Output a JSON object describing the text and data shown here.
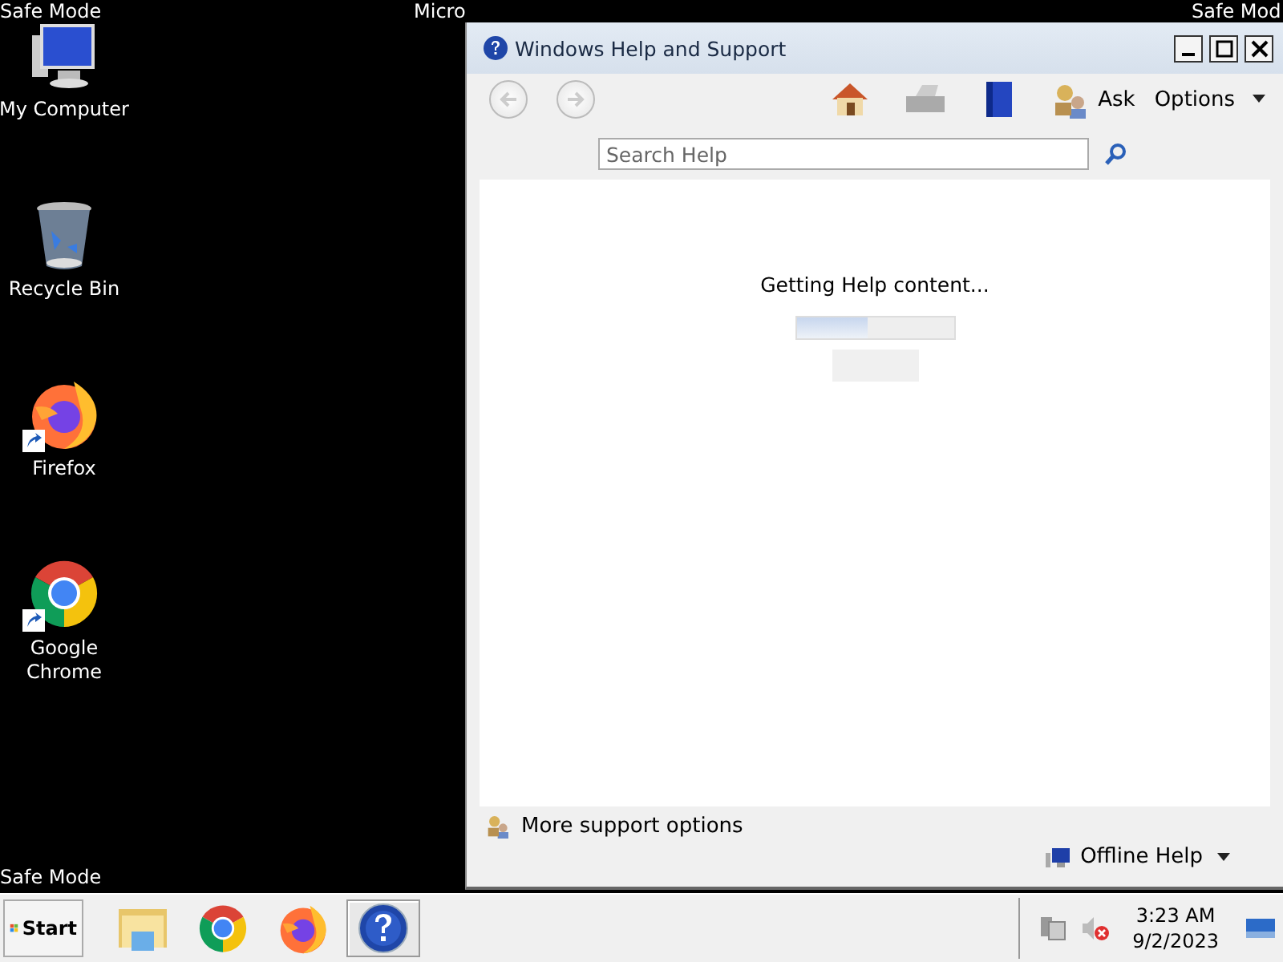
{
  "desktop": {
    "corner_labels": [
      {
        "kind": "top-left",
        "text": "Safe Mode"
      },
      {
        "kind": "top-center",
        "text": "Micro"
      },
      {
        "kind": "top-right",
        "text": "Safe Mod"
      },
      {
        "kind": "bottom-left",
        "text": "Safe Mode"
      }
    ],
    "icons": [
      {
        "kind": "computer",
        "label": "My Computer",
        "shortcut": false
      },
      {
        "kind": "recycle",
        "label": "Recycle Bin",
        "shortcut": false
      },
      {
        "kind": "firefox",
        "label": "Firefox",
        "shortcut": true
      },
      {
        "kind": "chrome",
        "label": "Google Chrome",
        "shortcut": true
      }
    ]
  },
  "help_window": {
    "title": "Windows Help and Support",
    "ask": "Ask",
    "options": "Options",
    "search": {
      "placeholder": "Search Help"
    },
    "status": "Getting Help content...",
    "progress": {
      "level": 0.45
    },
    "more_support": "More support options",
    "offline_help": "Offline Help"
  },
  "taskbar": {
    "start": "Start",
    "buttons": [
      {
        "kind": "explorer",
        "selected": false
      },
      {
        "kind": "chrome",
        "selected": false
      },
      {
        "kind": "firefox",
        "selected": false
      },
      {
        "kind": "help",
        "selected": true
      }
    ],
    "time": "3:23 AM",
    "date": "9/2/2023"
  }
}
